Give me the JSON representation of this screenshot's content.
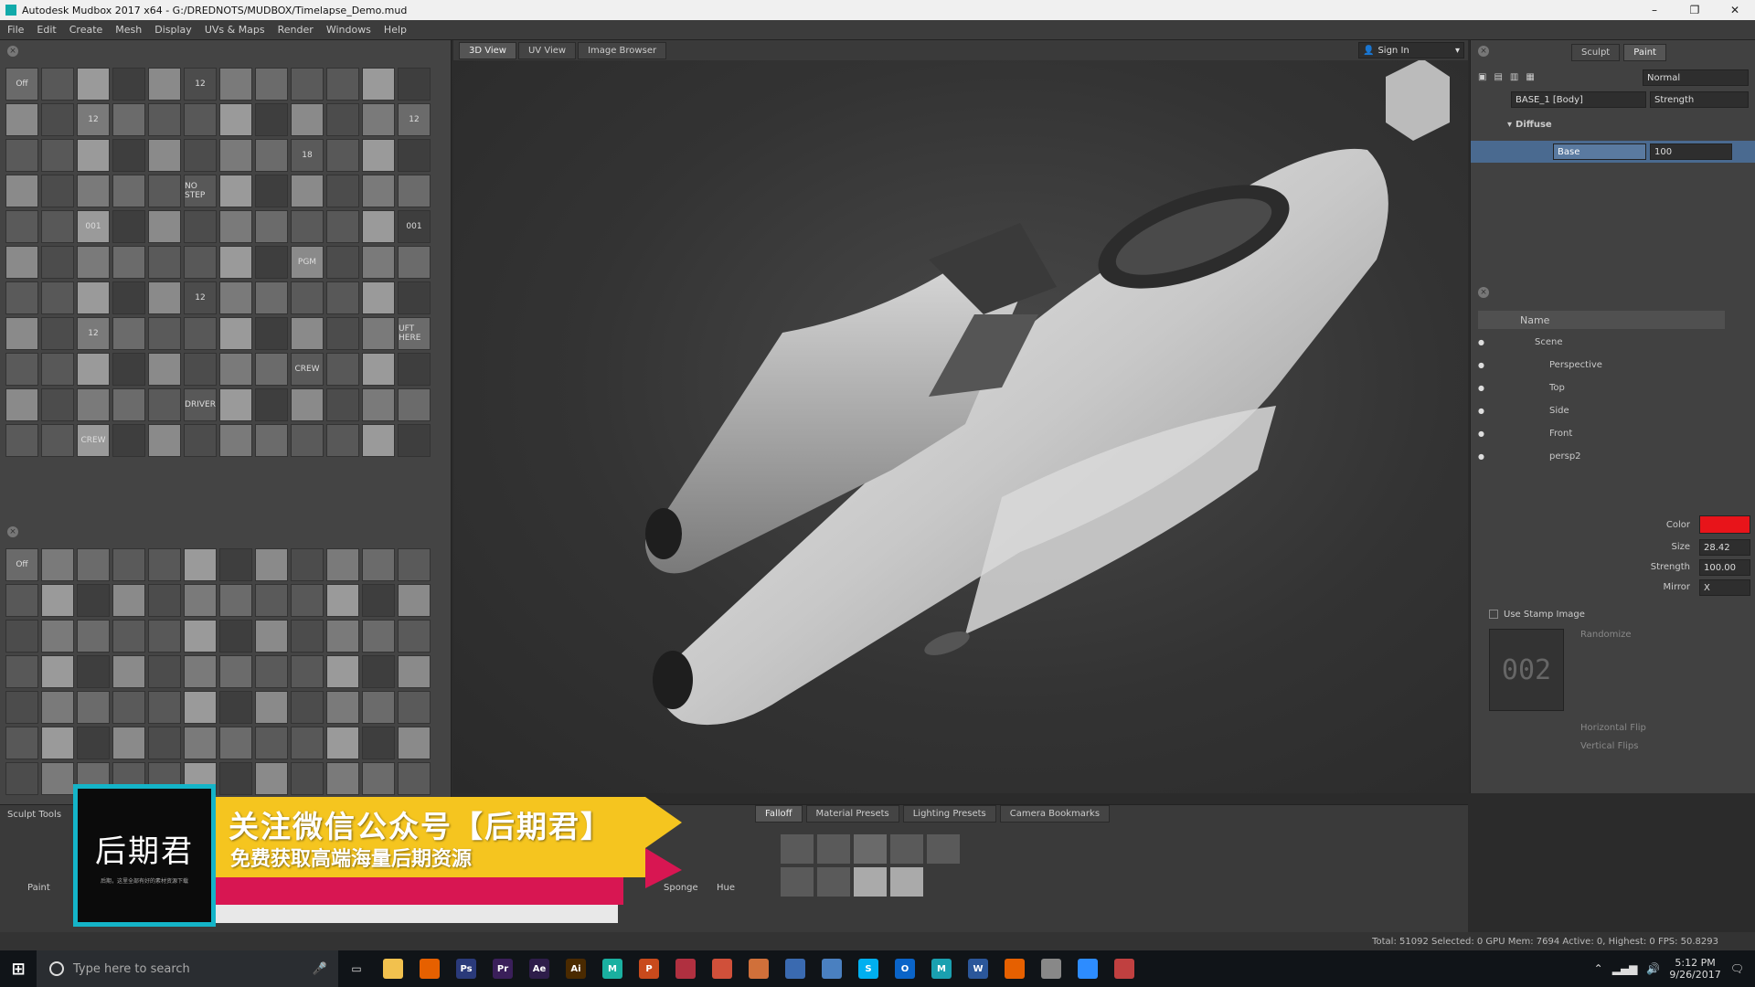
{
  "window": {
    "title": "Autodesk Mudbox 2017 x64 - G:/DREDNOTS/MUDBOX/Timelapse_Demo.mud",
    "controls": [
      "–",
      "❐",
      "✕"
    ]
  },
  "menu": [
    "File",
    "Edit",
    "Create",
    "Mesh",
    "Display",
    "UVs & Maps",
    "Render",
    "Windows",
    "Help"
  ],
  "view_tabs": [
    "3D View",
    "UV View",
    "Image Browser"
  ],
  "sign_in": "Sign In",
  "right_tabs": [
    "Sculpt",
    "Paint"
  ],
  "layers": {
    "blend_mode": "Normal",
    "layer_name": "BASE_1 [Body]",
    "strength_label": "Strength",
    "group": "Diffuse",
    "channel": "Base",
    "value": "100"
  },
  "object_list": {
    "header": "Name",
    "items": [
      "Scene",
      "Perspective",
      "Top",
      "Side",
      "Front",
      "persp2"
    ]
  },
  "properties": {
    "color_label": "Color",
    "color_value": "#e8141a",
    "size_label": "Size",
    "size_value": "28.42",
    "strength_label": "Strength",
    "strength_value": "100.00",
    "mirror_label": "Mirror",
    "mirror_value": "X",
    "use_stamp": "Use Stamp Image",
    "randomize": "Randomize",
    "hflip": "Horizontal Flip",
    "vflip": "Vertical Flips",
    "stamp_preview": "002"
  },
  "stamp_tray": {
    "off_label": "Off",
    "labels": [
      "12",
      "12",
      "12",
      "18",
      "NO STEP",
      "001",
      "001",
      "PGM",
      "12",
      "12",
      "UFT HERE",
      "CREW",
      "DRIVER",
      "CREW"
    ]
  },
  "bottom": {
    "left_tab": "Sculpt Tools",
    "tools": [
      "Paint",
      "Sponge",
      "Hue"
    ],
    "tabs": [
      "Falloff",
      "Material Presets",
      "Lighting Presets",
      "Camera Bookmarks"
    ]
  },
  "status": "Total: 51092  Selected: 0 GPU Mem: 7694  Active: 0, Highest: 0  FPS: 50.8293",
  "banner": {
    "logo_text": "后期君",
    "logo_sub": "后期，这里全部有好的素材资源下载",
    "line1": "关注微信公众号【后期君】",
    "line2": "免费获取高端海量后期资源"
  },
  "taskbar": {
    "search_placeholder": "Type here to search",
    "apps": [
      {
        "name": "file-explorer-icon",
        "label": "",
        "color": "#f2c14e"
      },
      {
        "name": "firefox-icon",
        "label": "",
        "color": "#e66000"
      },
      {
        "name": "photoshop-icon",
        "label": "Ps",
        "color": "#2a3a7a"
      },
      {
        "name": "premiere-icon",
        "label": "Pr",
        "color": "#3a1f5a"
      },
      {
        "name": "after-effects-icon",
        "label": "Ae",
        "color": "#2e1d4a"
      },
      {
        "name": "illustrator-icon",
        "label": "Ai",
        "color": "#4a2a00"
      },
      {
        "name": "mudbox-icon",
        "label": "M",
        "color": "#1ab0a0"
      },
      {
        "name": "powerpoint-icon",
        "label": "P",
        "color": "#c84a1c"
      },
      {
        "name": "app-red-icon",
        "label": "",
        "color": "#b03040"
      },
      {
        "name": "app-cone-icon",
        "label": "",
        "color": "#d0503a"
      },
      {
        "name": "app-cone2-icon",
        "label": "",
        "color": "#d0703a"
      },
      {
        "name": "app-globe-icon",
        "label": "",
        "color": "#3a6ab0"
      },
      {
        "name": "app-globe2-icon",
        "label": "",
        "color": "#4a80c0"
      },
      {
        "name": "skype-icon",
        "label": "S",
        "color": "#00aff0"
      },
      {
        "name": "outlook-icon",
        "label": "O",
        "color": "#0a64c8"
      },
      {
        "name": "mudbox2-icon",
        "label": "M",
        "color": "#1aa0b0"
      },
      {
        "name": "word-icon",
        "label": "W",
        "color": "#2b579a"
      },
      {
        "name": "firefox2-icon",
        "label": "",
        "color": "#e66000"
      },
      {
        "name": "app-diamond-icon",
        "label": "",
        "color": "#888"
      },
      {
        "name": "zoom-icon",
        "label": "",
        "color": "#2d8cff"
      },
      {
        "name": "app-diamond2-icon",
        "label": "",
        "color": "#c04040"
      }
    ],
    "time": "5:12 PM",
    "date": "9/26/2017"
  }
}
